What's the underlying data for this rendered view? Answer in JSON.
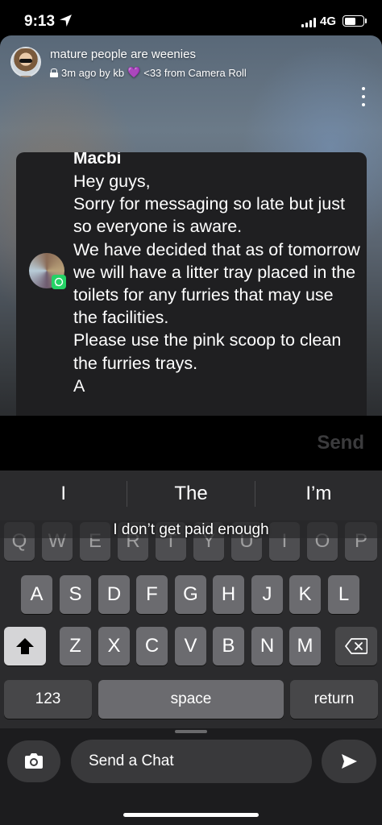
{
  "status": {
    "time": "9:13",
    "network": "4G"
  },
  "story": {
    "title": "mature people are weenies",
    "meta_prefix": "3m ago by kb",
    "heart": "💜",
    "meta_suffix": "<33 from Camera Roll"
  },
  "screenshot_card": {
    "sender": "Macbi",
    "message": "Hey guys,\nSorry for messaging so late but just so everyone is aware.\nWe have decided that as of tomorrow we will have a litter tray placed in the toilets for any furries that may use the facilities.\nPlease use the pink scoop to clean the furries trays.\nA"
  },
  "send_label": "Send",
  "keyboard": {
    "suggestions": [
      "I",
      "The",
      "I’m"
    ],
    "caption": "I don’t get paid enough",
    "row1": [
      "Q",
      "W",
      "E",
      "R",
      "T",
      "Y",
      "U",
      "I",
      "O",
      "P"
    ],
    "row2": [
      "A",
      "S",
      "D",
      "F",
      "G",
      "H",
      "J",
      "K",
      "L"
    ],
    "row3": [
      "Z",
      "X",
      "C",
      "V",
      "B",
      "N",
      "M"
    ],
    "numbers_label": "123",
    "space_label": "space",
    "return_label": "return"
  },
  "chat_bar": {
    "placeholder": "Send a Chat"
  }
}
